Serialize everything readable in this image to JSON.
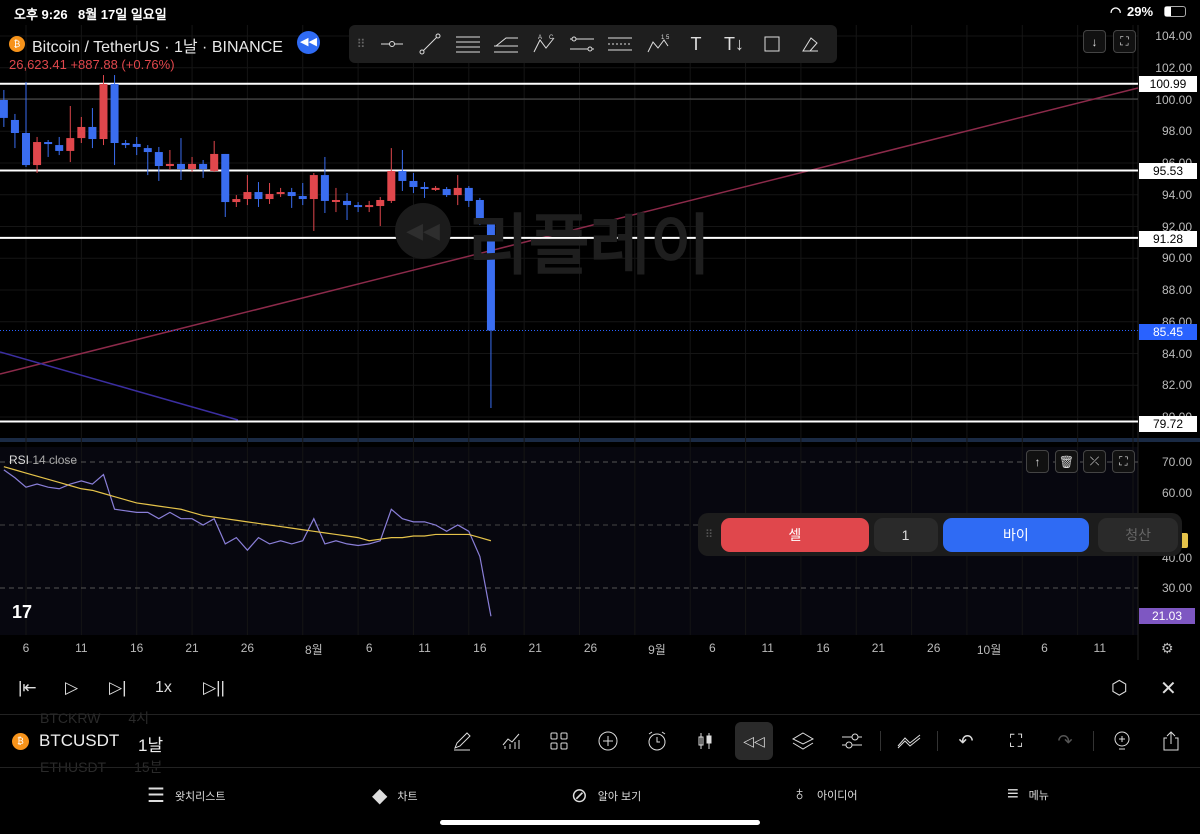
{
  "status": {
    "time": "오후 9:26",
    "date": "8월 17일 일요일",
    "battery": "29%"
  },
  "header": {
    "title": "Bitcoin / TetherUS · 1날 · BINANCE",
    "price": "26,623.41",
    "change": "+887.88 (+0.76%)"
  },
  "watermark": "리플레이",
  "price_axis": [
    "104.00",
    "102.00",
    "100.00",
    "98.00",
    "96.00",
    "94.00",
    "92.00",
    "90.00",
    "88.00",
    "86.00",
    "84.00",
    "82.00",
    "80.00"
  ],
  "hlines": [
    "100.99",
    "95.53",
    "91.28",
    "79.72"
  ],
  "last_price": "85.45",
  "rsi": {
    "label": "RSI",
    "params": "14 close",
    "axis": [
      "70.00",
      "60.00",
      "40.00",
      "30.00"
    ],
    "value": "21.03"
  },
  "dates": [
    "6",
    "11",
    "16",
    "21",
    "26",
    "8월",
    "6",
    "11",
    "16",
    "21",
    "26",
    "9월",
    "6",
    "11",
    "16",
    "21",
    "26",
    "10월",
    "6",
    "11"
  ],
  "trade": {
    "sell": "셀",
    "qty": "1",
    "buy": "바이",
    "close": "청산"
  },
  "replay": {
    "speed": "1x"
  },
  "symbol": {
    "name": "BTCUSDT",
    "interval": "1날",
    "prev": "BTCKRW",
    "prev_interval": "4시",
    "next": "ETHUSDT",
    "next_interval": "15분"
  },
  "tabs": [
    "왓치리스트",
    "차트",
    "알아 보기",
    "아이디어",
    "메뉴"
  ],
  "colors": {
    "up": "#e0474c",
    "down": "#3a6df0",
    "rsi": "#8a7fd8",
    "rsi_ma": "#e5c34a",
    "trend": "#8c2a4a",
    "accent": "#2962ff"
  },
  "chart_data": {
    "type": "candlestick",
    "ylim": [
      80,
      104
    ],
    "candles": [
      [
        99.97,
        100.6,
        98.27,
        98.84
      ],
      [
        98.71,
        99.09,
        96.94,
        97.89
      ],
      [
        97.89,
        101.1,
        95.75,
        95.87
      ],
      [
        95.87,
        97.64,
        95.37,
        97.32
      ],
      [
        97.32,
        97.45,
        96.38,
        97.2
      ],
      [
        97.13,
        97.64,
        96.5,
        96.76
      ],
      [
        96.76,
        99.59,
        96.06,
        97.57
      ],
      [
        97.57,
        98.9,
        97.26,
        98.27
      ],
      [
        98.27,
        99.46,
        96.94,
        97.51
      ],
      [
        97.51,
        101.54,
        97.13,
        100.98
      ],
      [
        100.98,
        101.54,
        95.87,
        97.26
      ],
      [
        97.26,
        97.45,
        96.94,
        97.13
      ],
      [
        97.2,
        97.64,
        96.5,
        97.01
      ],
      [
        96.94,
        97.13,
        95.24,
        96.69
      ],
      [
        96.69,
        97.01,
        94.87,
        95.81
      ],
      [
        95.81,
        96.82,
        95.56,
        95.94
      ],
      [
        95.94,
        97.57,
        94.93,
        95.62
      ],
      [
        95.62,
        96.38,
        95.43,
        95.94
      ],
      [
        95.94,
        96.19,
        95.06,
        95.62
      ],
      [
        95.5,
        97.39,
        95.43,
        96.57
      ],
      [
        96.57,
        96.57,
        92.6,
        93.54
      ],
      [
        93.54,
        93.98,
        93.23,
        93.73
      ],
      [
        93.73,
        95.24,
        93.35,
        94.17
      ],
      [
        94.17,
        94.8,
        93.23,
        93.73
      ],
      [
        93.73,
        94.74,
        93.42,
        94.05
      ],
      [
        94.05,
        94.43,
        93.86,
        94.17
      ],
      [
        94.17,
        94.43,
        93.17,
        93.92
      ],
      [
        93.92,
        94.74,
        93.35,
        93.73
      ],
      [
        93.73,
        95.37,
        91.72,
        95.24
      ],
      [
        95.24,
        96.38,
        92.85,
        93.61
      ],
      [
        93.61,
        94.43,
        92.91,
        93.67
      ],
      [
        93.61,
        94.11,
        92.41,
        93.35
      ],
      [
        93.35,
        93.54,
        92.91,
        93.23
      ],
      [
        93.23,
        93.61,
        92.91,
        93.35
      ],
      [
        93.29,
        93.86,
        92.03,
        93.67
      ],
      [
        93.61,
        96.94,
        93.48,
        95.5
      ],
      [
        95.5,
        96.82,
        94.24,
        94.87
      ],
      [
        94.87,
        95.37,
        94.11,
        94.49
      ],
      [
        94.49,
        94.8,
        93.8,
        94.43
      ],
      [
        94.36,
        94.55,
        94.24,
        94.43
      ],
      [
        94.36,
        94.49,
        93.86,
        93.98
      ],
      [
        93.98,
        95.24,
        93.35,
        94.43
      ],
      [
        94.43,
        94.55,
        93.23,
        93.61
      ],
      [
        93.67,
        93.8,
        92.09,
        92.16
      ],
      [
        92.16,
        92.28,
        80.57,
        85.45
      ]
    ],
    "rsi": [
      67.5,
      65,
      62,
      63,
      62,
      61.5,
      63,
      64,
      63,
      66,
      55,
      54.5,
      54,
      54,
      52,
      54,
      52,
      52,
      50,
      52,
      44,
      46,
      42,
      46,
      44,
      45,
      44,
      45,
      52,
      44,
      45,
      44,
      43.5,
      44,
      45,
      55,
      52,
      51,
      51,
      50,
      48,
      50,
      48,
      40,
      21.03
    ],
    "rsi_ma": [
      68.5,
      67.5,
      66.5,
      65.5,
      64.5,
      63.5,
      62.5,
      61.5,
      61,
      60,
      59,
      58,
      57,
      56.5,
      56,
      55.5,
      55,
      54,
      53,
      52.5,
      52,
      51.5,
      51,
      50.5,
      50,
      49.5,
      49,
      48.5,
      48,
      47.5,
      47,
      46.5,
      46,
      45,
      45.5,
      46,
      46,
      46.5,
      46.5,
      47,
      47,
      47,
      47,
      46,
      45
    ]
  }
}
